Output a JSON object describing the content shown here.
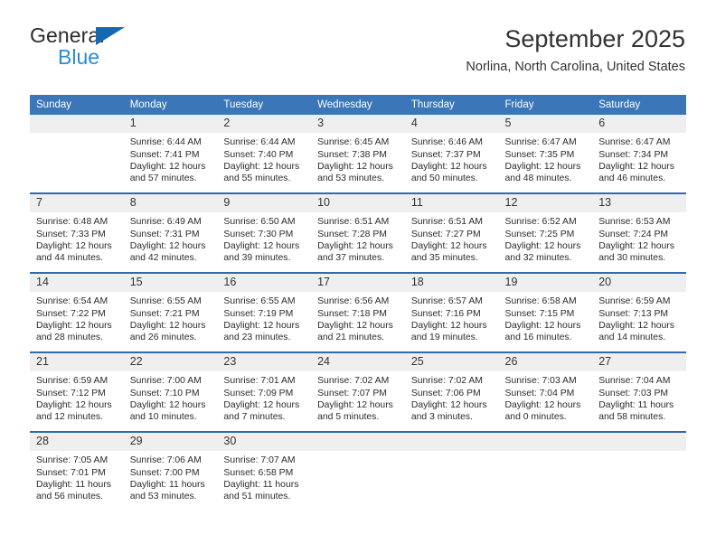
{
  "brand": {
    "name_top": "General",
    "name_bottom": "Blue",
    "accent_color": "#1669b0",
    "accent_color_light": "#2b8bd4"
  },
  "header": {
    "month_title": "September 2025",
    "location": "Norlina, North Carolina, United States"
  },
  "calendar": {
    "header_bg": "#3a76b8",
    "row_border_color": "#2e6cad",
    "daynum_bg": "#efefef",
    "weekday_headers": [
      "Sunday",
      "Monday",
      "Tuesday",
      "Wednesday",
      "Thursday",
      "Friday",
      "Saturday"
    ],
    "weeks": [
      [
        {
          "day": "",
          "lines": []
        },
        {
          "day": "1",
          "lines": [
            "Sunrise: 6:44 AM",
            "Sunset: 7:41 PM",
            "Daylight: 12 hours",
            "and 57 minutes."
          ]
        },
        {
          "day": "2",
          "lines": [
            "Sunrise: 6:44 AM",
            "Sunset: 7:40 PM",
            "Daylight: 12 hours",
            "and 55 minutes."
          ]
        },
        {
          "day": "3",
          "lines": [
            "Sunrise: 6:45 AM",
            "Sunset: 7:38 PM",
            "Daylight: 12 hours",
            "and 53 minutes."
          ]
        },
        {
          "day": "4",
          "lines": [
            "Sunrise: 6:46 AM",
            "Sunset: 7:37 PM",
            "Daylight: 12 hours",
            "and 50 minutes."
          ]
        },
        {
          "day": "5",
          "lines": [
            "Sunrise: 6:47 AM",
            "Sunset: 7:35 PM",
            "Daylight: 12 hours",
            "and 48 minutes."
          ]
        },
        {
          "day": "6",
          "lines": [
            "Sunrise: 6:47 AM",
            "Sunset: 7:34 PM",
            "Daylight: 12 hours",
            "and 46 minutes."
          ]
        }
      ],
      [
        {
          "day": "7",
          "lines": [
            "Sunrise: 6:48 AM",
            "Sunset: 7:33 PM",
            "Daylight: 12 hours",
            "and 44 minutes."
          ]
        },
        {
          "day": "8",
          "lines": [
            "Sunrise: 6:49 AM",
            "Sunset: 7:31 PM",
            "Daylight: 12 hours",
            "and 42 minutes."
          ]
        },
        {
          "day": "9",
          "lines": [
            "Sunrise: 6:50 AM",
            "Sunset: 7:30 PM",
            "Daylight: 12 hours",
            "and 39 minutes."
          ]
        },
        {
          "day": "10",
          "lines": [
            "Sunrise: 6:51 AM",
            "Sunset: 7:28 PM",
            "Daylight: 12 hours",
            "and 37 minutes."
          ]
        },
        {
          "day": "11",
          "lines": [
            "Sunrise: 6:51 AM",
            "Sunset: 7:27 PM",
            "Daylight: 12 hours",
            "and 35 minutes."
          ]
        },
        {
          "day": "12",
          "lines": [
            "Sunrise: 6:52 AM",
            "Sunset: 7:25 PM",
            "Daylight: 12 hours",
            "and 32 minutes."
          ]
        },
        {
          "day": "13",
          "lines": [
            "Sunrise: 6:53 AM",
            "Sunset: 7:24 PM",
            "Daylight: 12 hours",
            "and 30 minutes."
          ]
        }
      ],
      [
        {
          "day": "14",
          "lines": [
            "Sunrise: 6:54 AM",
            "Sunset: 7:22 PM",
            "Daylight: 12 hours",
            "and 28 minutes."
          ]
        },
        {
          "day": "15",
          "lines": [
            "Sunrise: 6:55 AM",
            "Sunset: 7:21 PM",
            "Daylight: 12 hours",
            "and 26 minutes."
          ]
        },
        {
          "day": "16",
          "lines": [
            "Sunrise: 6:55 AM",
            "Sunset: 7:19 PM",
            "Daylight: 12 hours",
            "and 23 minutes."
          ]
        },
        {
          "day": "17",
          "lines": [
            "Sunrise: 6:56 AM",
            "Sunset: 7:18 PM",
            "Daylight: 12 hours",
            "and 21 minutes."
          ]
        },
        {
          "day": "18",
          "lines": [
            "Sunrise: 6:57 AM",
            "Sunset: 7:16 PM",
            "Daylight: 12 hours",
            "and 19 minutes."
          ]
        },
        {
          "day": "19",
          "lines": [
            "Sunrise: 6:58 AM",
            "Sunset: 7:15 PM",
            "Daylight: 12 hours",
            "and 16 minutes."
          ]
        },
        {
          "day": "20",
          "lines": [
            "Sunrise: 6:59 AM",
            "Sunset: 7:13 PM",
            "Daylight: 12 hours",
            "and 14 minutes."
          ]
        }
      ],
      [
        {
          "day": "21",
          "lines": [
            "Sunrise: 6:59 AM",
            "Sunset: 7:12 PM",
            "Daylight: 12 hours",
            "and 12 minutes."
          ]
        },
        {
          "day": "22",
          "lines": [
            "Sunrise: 7:00 AM",
            "Sunset: 7:10 PM",
            "Daylight: 12 hours",
            "and 10 minutes."
          ]
        },
        {
          "day": "23",
          "lines": [
            "Sunrise: 7:01 AM",
            "Sunset: 7:09 PM",
            "Daylight: 12 hours",
            "and 7 minutes."
          ]
        },
        {
          "day": "24",
          "lines": [
            "Sunrise: 7:02 AM",
            "Sunset: 7:07 PM",
            "Daylight: 12 hours",
            "and 5 minutes."
          ]
        },
        {
          "day": "25",
          "lines": [
            "Sunrise: 7:02 AM",
            "Sunset: 7:06 PM",
            "Daylight: 12 hours",
            "and 3 minutes."
          ]
        },
        {
          "day": "26",
          "lines": [
            "Sunrise: 7:03 AM",
            "Sunset: 7:04 PM",
            "Daylight: 12 hours",
            "and 0 minutes."
          ]
        },
        {
          "day": "27",
          "lines": [
            "Sunrise: 7:04 AM",
            "Sunset: 7:03 PM",
            "Daylight: 11 hours",
            "and 58 minutes."
          ]
        }
      ],
      [
        {
          "day": "28",
          "lines": [
            "Sunrise: 7:05 AM",
            "Sunset: 7:01 PM",
            "Daylight: 11 hours",
            "and 56 minutes."
          ]
        },
        {
          "day": "29",
          "lines": [
            "Sunrise: 7:06 AM",
            "Sunset: 7:00 PM",
            "Daylight: 11 hours",
            "and 53 minutes."
          ]
        },
        {
          "day": "30",
          "lines": [
            "Sunrise: 7:07 AM",
            "Sunset: 6:58 PM",
            "Daylight: 11 hours",
            "and 51 minutes."
          ]
        },
        {
          "day": "",
          "lines": []
        },
        {
          "day": "",
          "lines": []
        },
        {
          "day": "",
          "lines": []
        },
        {
          "day": "",
          "lines": []
        }
      ]
    ]
  }
}
